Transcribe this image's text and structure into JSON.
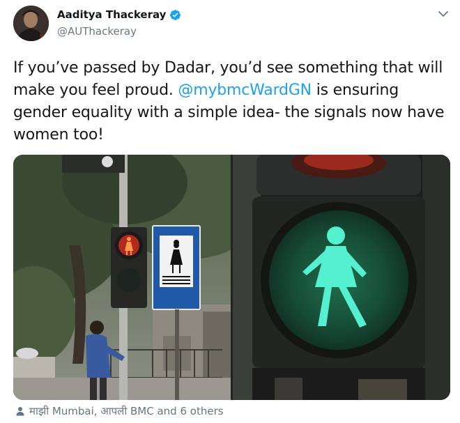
{
  "tweet": {
    "display_name": "Aaditya Thackeray",
    "handle": "@AUThackeray",
    "text_before": "If you’ve passed by Dadar, you’d see something that will make you feel proud. ",
    "mention": "@mybmcWardGN",
    "text_after": " is ensuring gender equality with a simple idea- the signals now have women too!",
    "tagged_people": "माझी Mumbai, आपली BMC and 6 others"
  },
  "icons": {
    "verified": "verified-badge-icon",
    "caret": "chevron-down-icon",
    "tag": "person-icon"
  },
  "colors": {
    "link": "#1da1f2",
    "secondary_text": "#657786",
    "signal_green": "#3fe0c0",
    "signal_red": "#ff5a2a"
  }
}
